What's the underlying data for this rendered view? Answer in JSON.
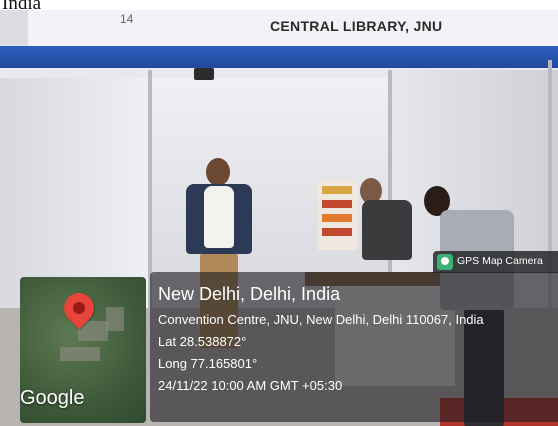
{
  "caption": {
    "top_text": "India"
  },
  "scene": {
    "stall_number": "14",
    "sign_text": "CENTRAL LIBRARY, JNU",
    "colors": {
      "blue_band": "#2c5fc2",
      "wall": "#e6e7ec",
      "carpet": "#b3342a"
    }
  },
  "overlay": {
    "badge_label": "GPS Map Camera",
    "badge_icon": "map-pin-icon",
    "map_logo": "Google",
    "location_title": "New Delhi, Delhi, India",
    "address": "Convention Centre, JNU, New Delhi, Delhi 110067, India",
    "latitude": "Lat 28.538872°",
    "longitude": "Long 77.165801°",
    "timestamp": "24/11/22 10:00 AM GMT +05:30"
  }
}
